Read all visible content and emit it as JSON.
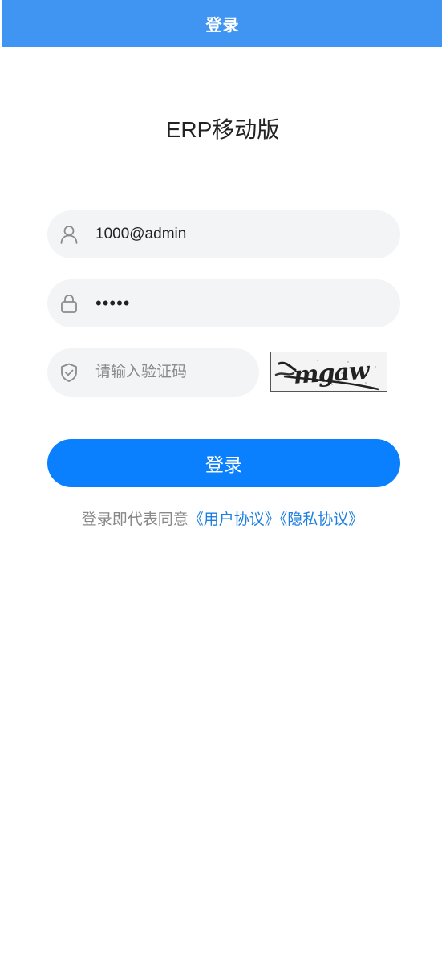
{
  "navbar": {
    "title": "登录",
    "color": "#4095f2"
  },
  "app": {
    "title": "ERP移动版"
  },
  "form": {
    "username": {
      "value": "1000@admin",
      "icon": "user-icon"
    },
    "password": {
      "value": "•••••",
      "icon": "lock-icon"
    },
    "captcha": {
      "value": "",
      "placeholder": "请输入验证码",
      "icon": "shield-check-icon",
      "image_text": "mgaw"
    }
  },
  "login_button": {
    "label": "登录",
    "color": "#0a80ff"
  },
  "agreement": {
    "prefix": "登录即代表同意",
    "user_agreement": "《用户协议》",
    "privacy_policy": "《隐私协议》",
    "link_color": "#1f7fe0"
  }
}
